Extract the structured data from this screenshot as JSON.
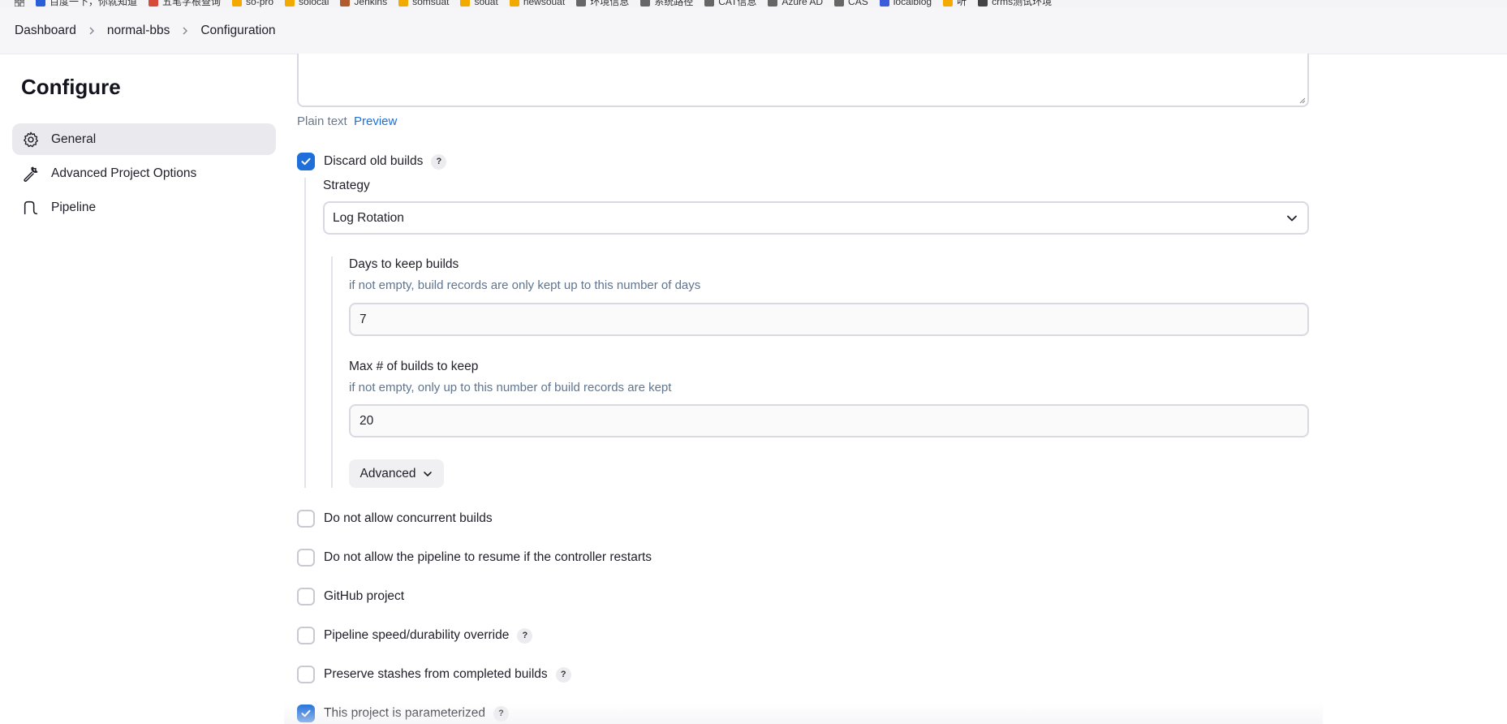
{
  "bookmarks": [
    {
      "label": "百度一下，你就知道",
      "color": "#2b5fd9"
    },
    {
      "label": "五笔字根查询",
      "color": "#d94a3a"
    },
    {
      "label": "so-pro",
      "color": "#f2a900"
    },
    {
      "label": "solocal",
      "color": "#f2a900"
    },
    {
      "label": "Jenkins",
      "color": "#b05a2e"
    },
    {
      "label": "somsuat",
      "color": "#f2a900"
    },
    {
      "label": "souat",
      "color": "#f2a900"
    },
    {
      "label": "newsouat",
      "color": "#f2a900"
    },
    {
      "label": "环境信息",
      "color": "#666666"
    },
    {
      "label": "系统路径",
      "color": "#666666"
    },
    {
      "label": "CAT信息",
      "color": "#666666"
    },
    {
      "label": "Azure AD",
      "color": "#666666"
    },
    {
      "label": "CAS",
      "color": "#666666"
    },
    {
      "label": "localblog",
      "color": "#3b5bdb"
    },
    {
      "label": "听",
      "color": "#f2a900"
    },
    {
      "label": "crms测试环境",
      "color": "#444444"
    }
  ],
  "breadcrumb": {
    "items": [
      "Dashboard",
      "normal-bbs",
      "Configuration"
    ]
  },
  "sidebar": {
    "title": "Configure",
    "items": [
      {
        "label": "General",
        "icon": "gear-icon",
        "active": true
      },
      {
        "label": "Advanced Project Options",
        "icon": "wrench-icon",
        "active": false
      },
      {
        "label": "Pipeline",
        "icon": "pipeline-icon",
        "active": false
      }
    ]
  },
  "description": {
    "plain_text_label": "Plain text",
    "preview_label": "Preview"
  },
  "discard_old_builds": {
    "label": "Discard old builds",
    "checked": true,
    "help": "?",
    "strategy_label": "Strategy",
    "strategy_value": "Log Rotation",
    "days_label": "Days to keep builds",
    "days_desc": "if not empty, build records are only kept up to this number of days",
    "days_value": "7",
    "max_label": "Max # of builds to keep",
    "max_desc": "if not empty, only up to this number of build records are kept",
    "max_value": "20",
    "advanced_label": "Advanced"
  },
  "options": [
    {
      "label": "Do not allow concurrent builds",
      "checked": false,
      "help": false
    },
    {
      "label": "Do not allow the pipeline to resume if the controller restarts",
      "checked": false,
      "help": false
    },
    {
      "label": "GitHub project",
      "checked": false,
      "help": false
    },
    {
      "label": "Pipeline speed/durability override",
      "checked": false,
      "help": true
    },
    {
      "label": "Preserve stashes from completed builds",
      "checked": false,
      "help": true
    },
    {
      "label": "This project is parameterized",
      "checked": true,
      "help": true
    }
  ],
  "colors": {
    "accent": "#1e6fd9",
    "muted_text": "#5f7590",
    "border": "#d9d9e3"
  }
}
